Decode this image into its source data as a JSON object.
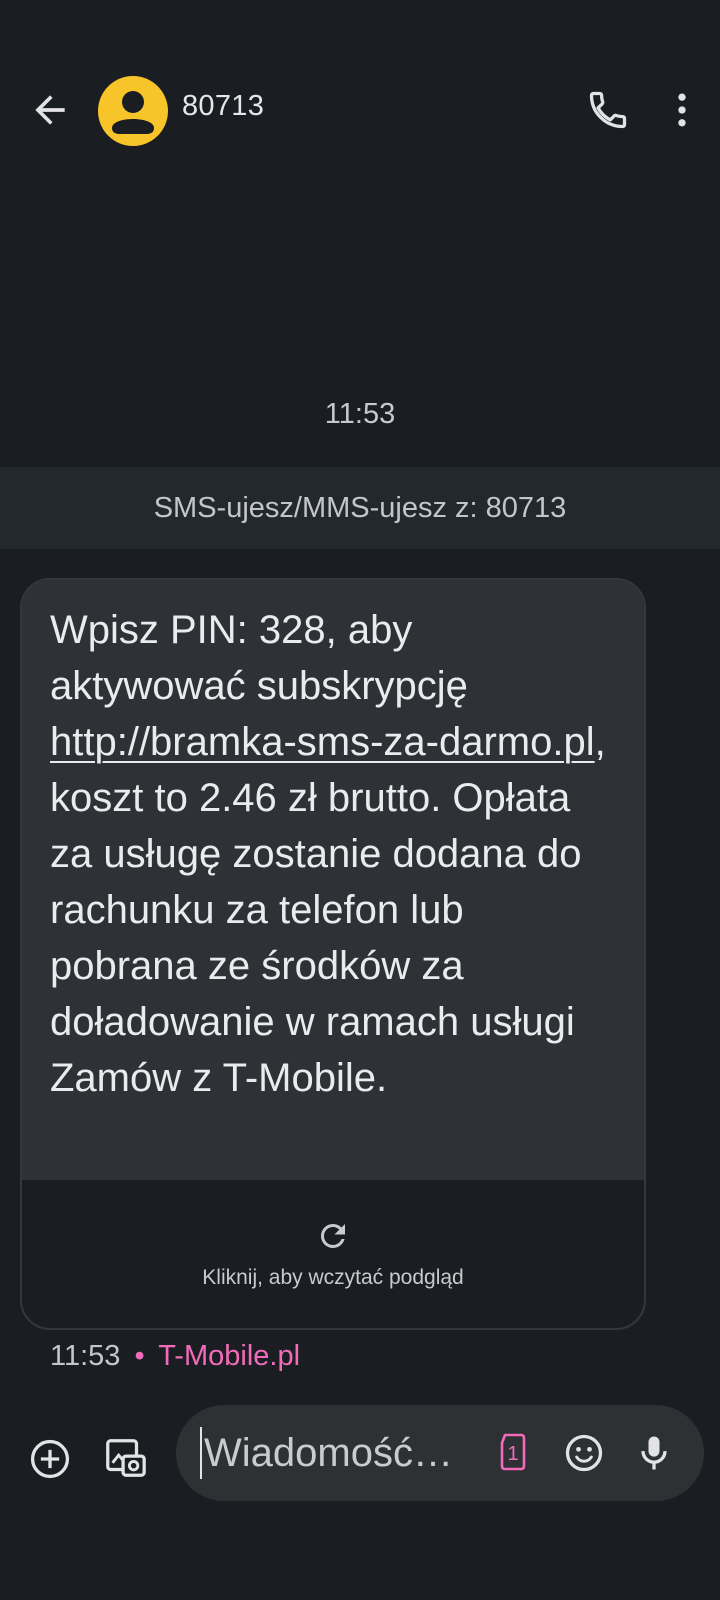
{
  "header": {
    "title": "80713",
    "back_icon": "arrow-back-icon",
    "avatar_icon": "person-avatar-icon",
    "call_icon": "phone-icon",
    "more_icon": "more-vertical-icon",
    "avatar_color": "#f7c42a"
  },
  "conversation": {
    "timestamp": "11:53",
    "banner_text": "SMS-ujesz/MMS-ujesz z: 80713"
  },
  "message": {
    "text_before_link": "Wpisz PIN: 328, aby aktywować subskrypcję ",
    "link_text": "http://bramka-sms-za-darmo.pl",
    "text_after_link": ", koszt to 2.46 zł brutto. Opłata za usługę zostanie dodana do rachunku za telefon lub pobrana ze środków za doładowanie w ramach usługi Zamów z T-Mobile.",
    "preview_label": "Kliknij, aby wczytać podgląd",
    "refresh_icon": "refresh-icon",
    "time": "11:53",
    "separator": "•",
    "carrier": "T-Mobile.pl",
    "carrier_color": "#f26bba"
  },
  "compose": {
    "placeholder": "Wiadomość…",
    "add_icon": "add-circle-icon",
    "gallery_icon": "gallery-icon",
    "sim_icon": "sim-1-icon",
    "sim_label": "1",
    "emoji_icon": "emoji-icon",
    "mic_icon": "microphone-icon"
  }
}
